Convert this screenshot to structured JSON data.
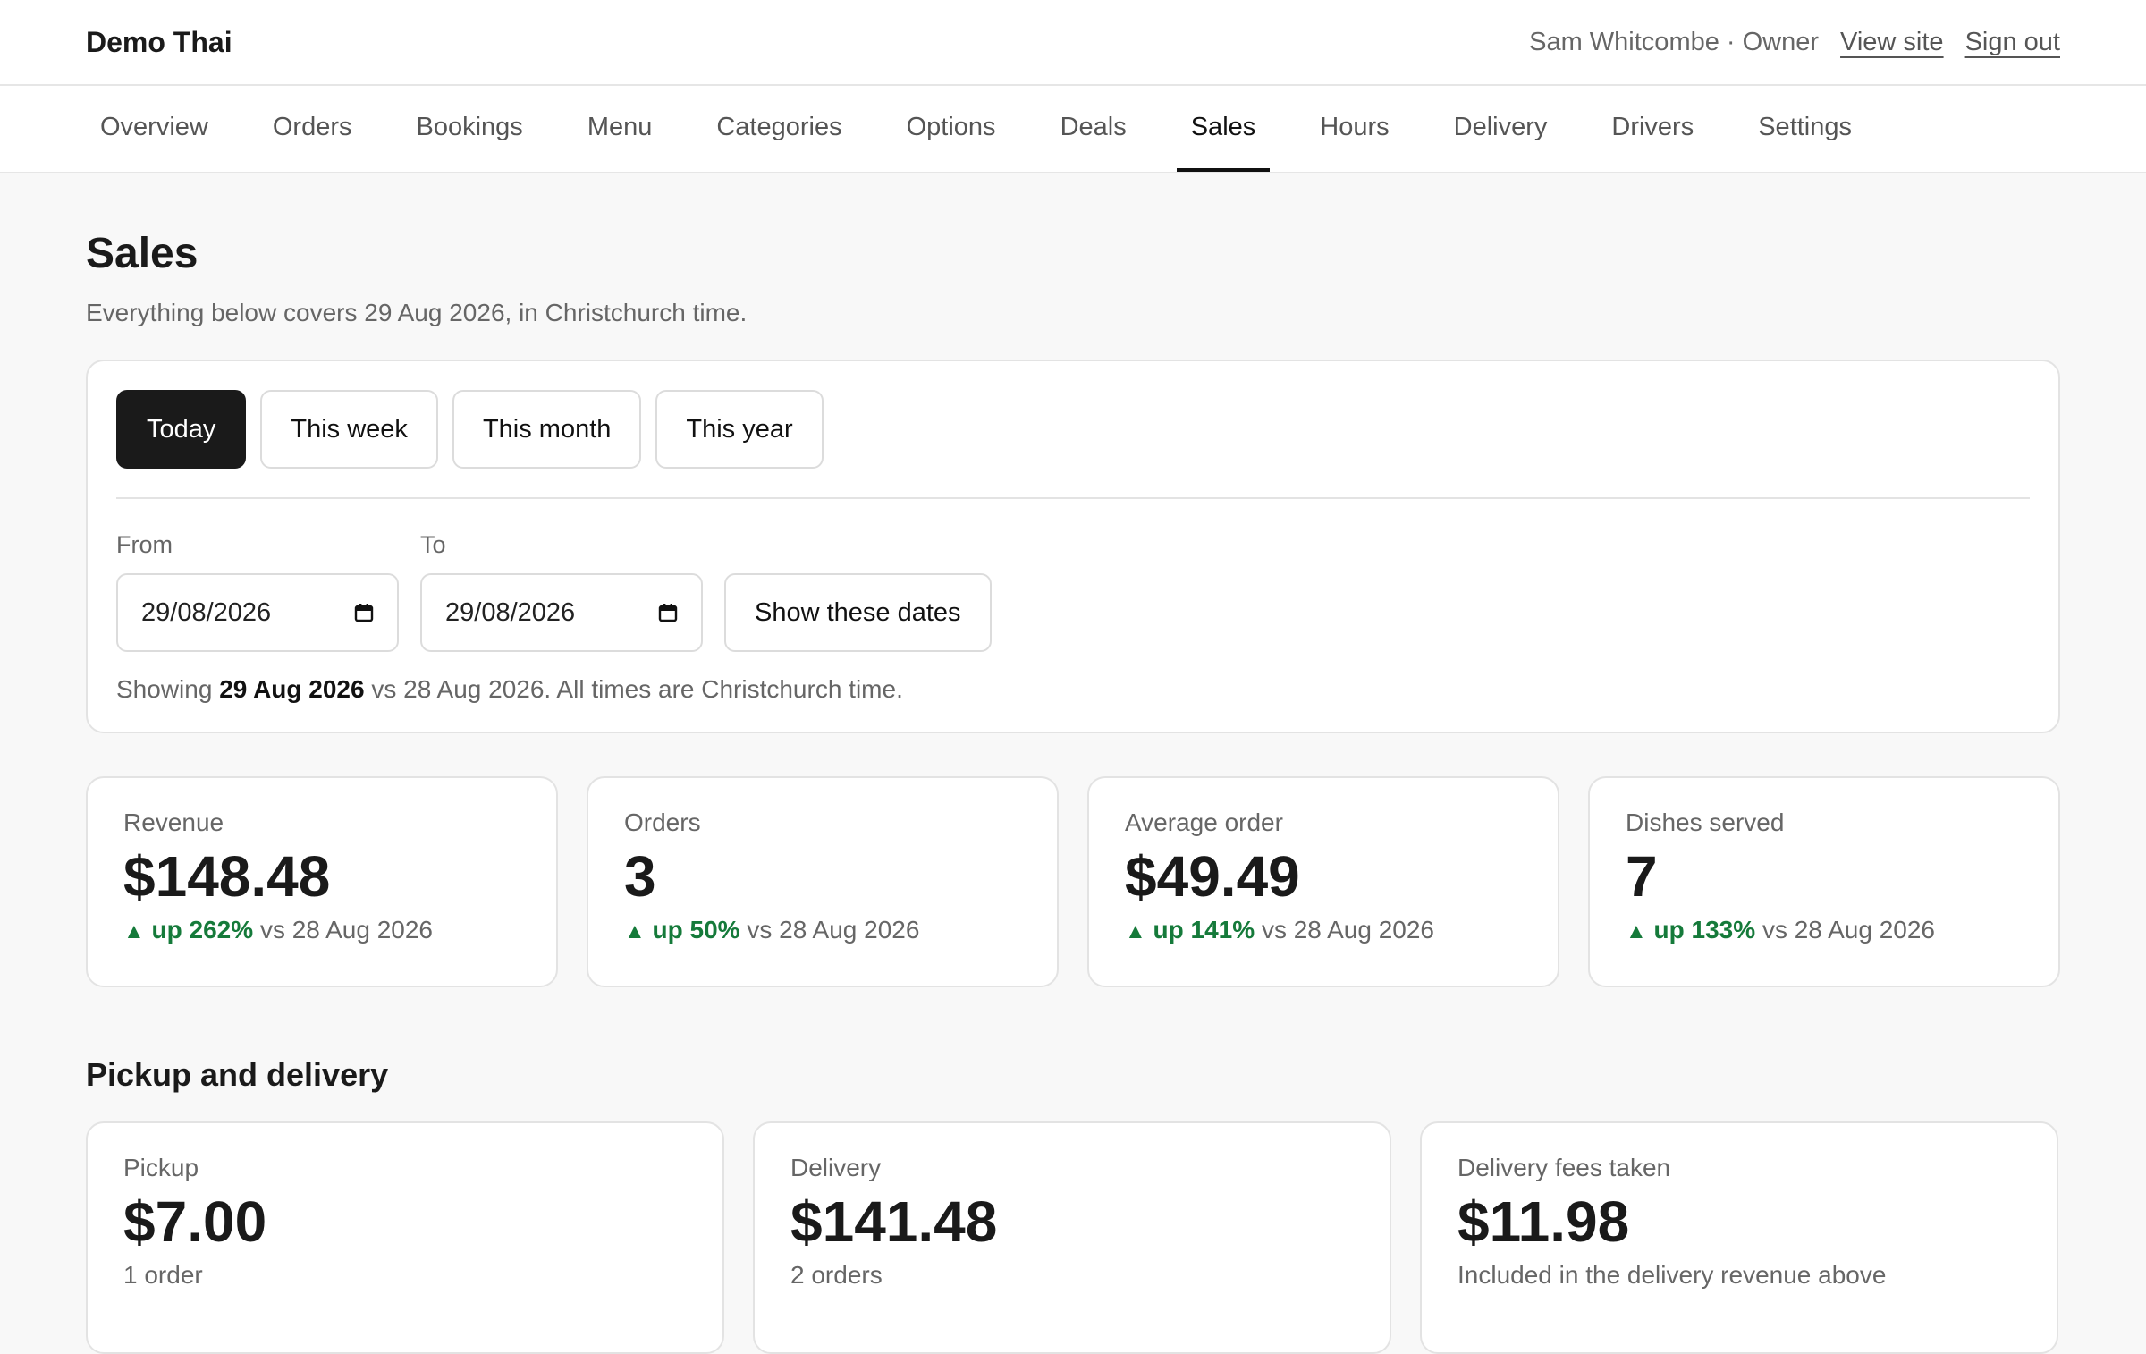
{
  "app": {
    "title": "Demo Thai",
    "user": "Sam Whitcombe · Owner",
    "view_site": "View site",
    "sign_out": "Sign out"
  },
  "nav": {
    "tabs": [
      {
        "label": "Overview"
      },
      {
        "label": "Orders"
      },
      {
        "label": "Bookings"
      },
      {
        "label": "Menu"
      },
      {
        "label": "Categories"
      },
      {
        "label": "Options"
      },
      {
        "label": "Deals"
      },
      {
        "label": "Sales",
        "active": true
      },
      {
        "label": "Hours"
      },
      {
        "label": "Delivery"
      },
      {
        "label": "Drivers"
      },
      {
        "label": "Settings"
      }
    ]
  },
  "page": {
    "title": "Sales",
    "subtitle": "Everything below covers 29 Aug 2026, in Christchurch time."
  },
  "range": {
    "presets": [
      {
        "label": "Today",
        "active": true
      },
      {
        "label": "This week"
      },
      {
        "label": "This month"
      },
      {
        "label": "This year"
      }
    ],
    "from_label": "From",
    "from_value": "29/08/2026",
    "to_label": "To",
    "to_value": "29/08/2026",
    "show_button": "Show these dates",
    "showing_prefix": "Showing",
    "showing_date": "29 Aug 2026",
    "showing_suffix": "vs 28 Aug 2026. All times are Christchurch time."
  },
  "stats": [
    {
      "label": "Revenue",
      "value": "$148.48",
      "arrow": "▲",
      "change": "up 262%",
      "compare": "vs 28 Aug 2026"
    },
    {
      "label": "Orders",
      "value": "3",
      "arrow": "▲",
      "change": "up 50%",
      "compare": "vs 28 Aug 2026"
    },
    {
      "label": "Average order",
      "value": "$49.49",
      "arrow": "▲",
      "change": "up 141%",
      "compare": "vs 28 Aug 2026"
    },
    {
      "label": "Dishes served",
      "value": "7",
      "arrow": "▲",
      "change": "up 133%",
      "compare": "vs 28 Aug 2026"
    }
  ],
  "pickup_delivery": {
    "heading": "Pickup and delivery",
    "cards": [
      {
        "label": "Pickup",
        "value": "$7.00",
        "note": "1 order"
      },
      {
        "label": "Delivery",
        "value": "$141.48",
        "note": "2 orders"
      },
      {
        "label": "Delivery fees taken",
        "value": "$11.98",
        "note": "Included in the delivery revenue above"
      }
    ]
  },
  "colors": {
    "accent": "#1a1a1a",
    "positive": "#157a3a",
    "background": "#f8f8f8"
  }
}
